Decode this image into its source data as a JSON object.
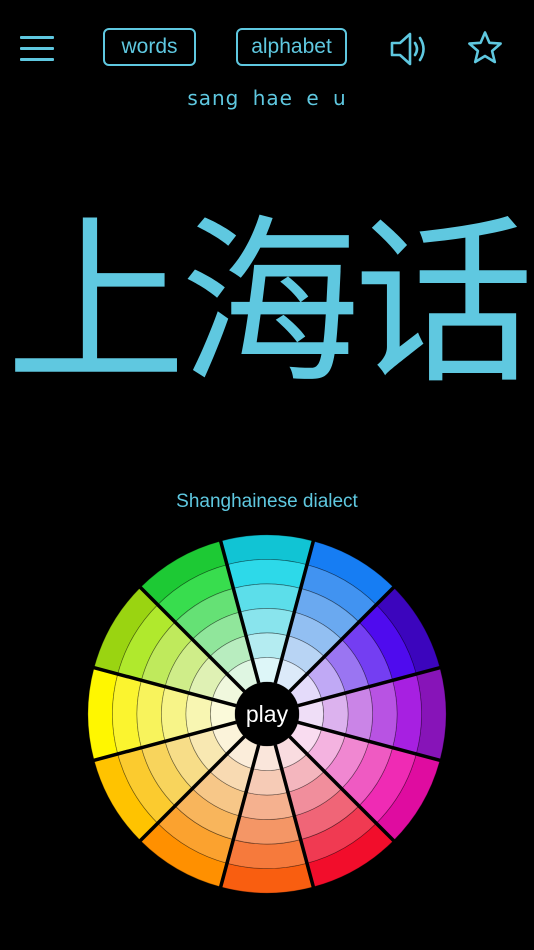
{
  "header": {
    "words_label": "words",
    "alphabet_label": "alphabet"
  },
  "romanization": "sang hae e u",
  "characters": "上海话",
  "subtitle": "Shanghainese dialect",
  "wheel": {
    "play_label": "play",
    "segments": [
      {
        "hue": 185,
        "sat": 85,
        "light": 45
      },
      {
        "hue": 212,
        "sat": 90,
        "light": 52
      },
      {
        "hue": 258,
        "sat": 95,
        "light": 38
      },
      {
        "hue": 282,
        "sat": 80,
        "light": 40
      },
      {
        "hue": 318,
        "sat": 90,
        "light": 46
      },
      {
        "hue": 352,
        "sat": 90,
        "light": 50
      },
      {
        "hue": 20,
        "sat": 95,
        "light": 52
      },
      {
        "hue": 34,
        "sat": 100,
        "light": 50
      },
      {
        "hue": 46,
        "sat": 100,
        "light": 50
      },
      {
        "hue": 58,
        "sat": 100,
        "light": 50
      },
      {
        "hue": 78,
        "sat": 85,
        "light": 45
      },
      {
        "hue": 128,
        "sat": 75,
        "light": 45
      }
    ]
  },
  "colors": {
    "accent": "#5fc8e0",
    "background": "#000000"
  }
}
